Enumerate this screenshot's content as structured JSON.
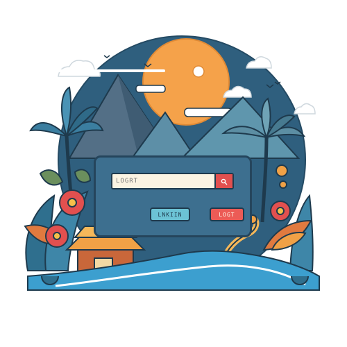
{
  "search": {
    "placeholder": "LOGRT"
  },
  "buttons": {
    "login_label": "LNKIIN",
    "logout_label": "LOGT"
  },
  "icons": {
    "search": "search-icon",
    "sun": "sun-icon",
    "mountain": "mountain-icon",
    "palm": "palm-tree-icon",
    "flower": "hibiscus-icon",
    "temple": "temple-icon",
    "dragon": "dragon-icon",
    "cloud": "cloud-icon",
    "bird": "bird-icon"
  },
  "colors": {
    "sky": "#2f5f7e",
    "sun": "#f5a24a",
    "panel": "#3d6f8f",
    "accent_red": "#e2504f",
    "accent_cyan": "#6cc3d5",
    "water": "#3c9fcf"
  }
}
